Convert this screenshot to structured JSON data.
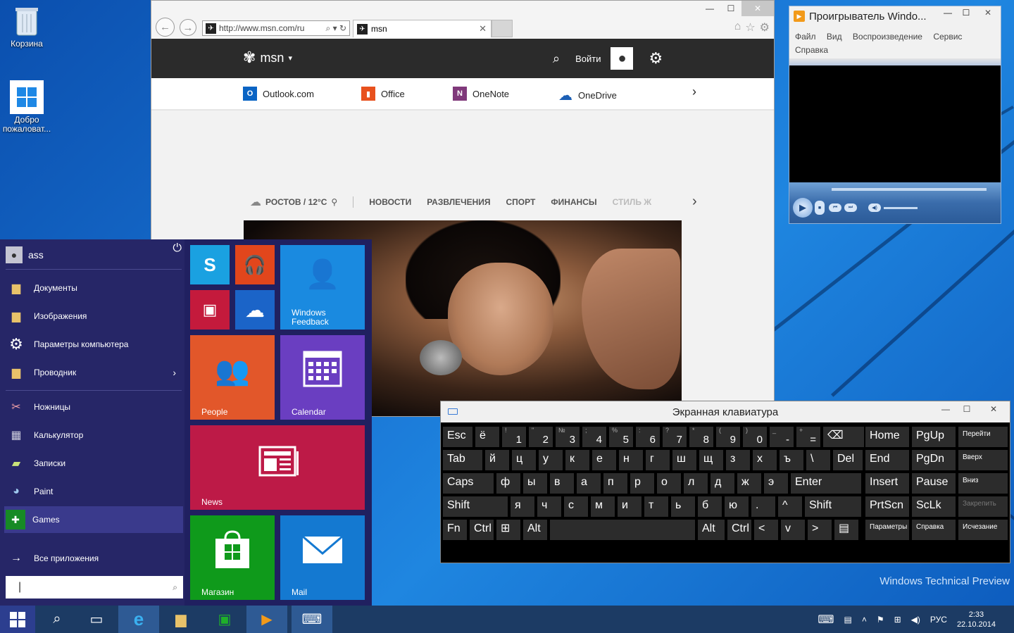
{
  "desktop": {
    "icons": [
      {
        "label": "Корзина"
      },
      {
        "label": "Добро пожаловат..."
      }
    ],
    "watermark": "Windows Technical Preview"
  },
  "ie": {
    "address": "http://www.msn.com/ru",
    "tab_title": "msn",
    "msn_logo": "msn",
    "signin": "Войти",
    "app_links": [
      "Outlook.com",
      "Office",
      "OneNote",
      "OneDrive"
    ],
    "weather": "РОСТОВ / 12°C",
    "nav": [
      "НОВОСТИ",
      "РАЗВЛЕЧЕНИЯ",
      "СПОРТ",
      "ФИНАНСЫ",
      "СТИЛЬ Ж"
    ]
  },
  "wmp": {
    "title": "Проигрыватель Windo...",
    "menu": [
      "Файл",
      "Вид",
      "Воспроизведение",
      "Сервис",
      "Справка"
    ]
  },
  "start": {
    "user": "ass",
    "items": [
      {
        "label": "Документы"
      },
      {
        "label": "Изображения"
      },
      {
        "label": "Параметры компьютера"
      },
      {
        "label": "Проводник"
      },
      {
        "label": "Ножницы"
      },
      {
        "label": "Калькулятор"
      },
      {
        "label": "Записки"
      },
      {
        "label": "Paint"
      },
      {
        "label": "Games"
      }
    ],
    "all_apps": "Все приложения",
    "search_value": "|",
    "tiles": {
      "windows_feedback": "Windows Feedback",
      "people": "People",
      "calendar": "Calendar",
      "news": "News",
      "store": "Магазин",
      "mail": "Mail"
    }
  },
  "osk": {
    "title": "Экранная клавиатура",
    "row1": [
      {
        "main": "Esc"
      },
      {
        "main": "ё"
      },
      {
        "sh": "!",
        "mn": "1"
      },
      {
        "sh": "\"",
        "mn": "2"
      },
      {
        "sh": "№",
        "mn": "3"
      },
      {
        "sh": ";",
        "mn": "4"
      },
      {
        "sh": "%",
        "mn": "5"
      },
      {
        "sh": ":",
        "mn": "6"
      },
      {
        "sh": "?",
        "mn": "7"
      },
      {
        "sh": "*",
        "mn": "8"
      },
      {
        "sh": "(",
        "mn": "9"
      },
      {
        "sh": ")",
        "mn": "0"
      },
      {
        "sh": "_",
        "mn": "-"
      },
      {
        "sh": "+",
        "mn": "="
      },
      {
        "main": "⌫"
      }
    ],
    "row2": [
      "Tab",
      "й",
      "ц",
      "у",
      "к",
      "е",
      "н",
      "г",
      "ш",
      "щ",
      "з",
      "х",
      "ъ",
      "\\",
      "Del"
    ],
    "row3": [
      "Caps",
      "ф",
      "ы",
      "в",
      "а",
      "п",
      "р",
      "о",
      "л",
      "д",
      "ж",
      "э",
      "Enter"
    ],
    "row4": [
      "Shift",
      "я",
      "ч",
      "с",
      "м",
      "и",
      "т",
      "ь",
      "б",
      "ю",
      ".",
      "^",
      "Shift"
    ],
    "row5": [
      "Fn",
      "Ctrl",
      "⊞",
      "Alt",
      "",
      "Alt",
      "Ctrl",
      "<",
      "v",
      ">",
      "▤"
    ],
    "nav": [
      "Home",
      "PgUp",
      "Перейти",
      "End",
      "PgDn",
      "Вверх",
      "Insert",
      "Pause",
      "Вниз",
      "PrtScn",
      "ScLk",
      "Закрепить",
      "Параметры",
      "Справка",
      "Исчезание"
    ]
  },
  "tray": {
    "lang": "РУС",
    "time": "2:33",
    "date": "22.10.2014"
  }
}
